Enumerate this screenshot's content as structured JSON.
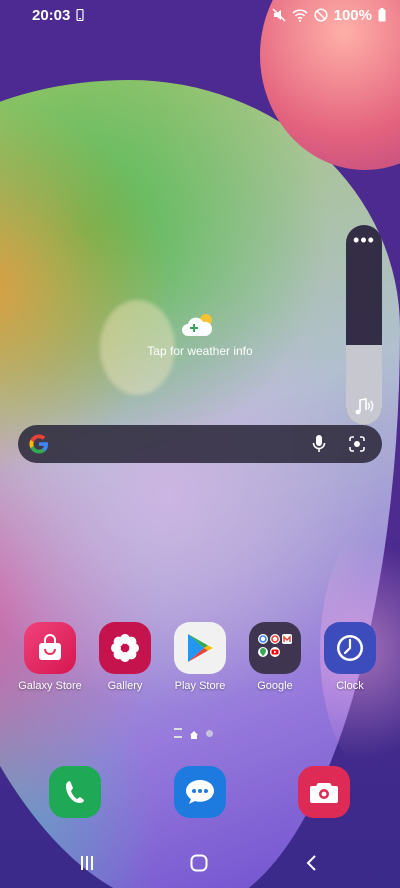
{
  "status_bar": {
    "time": "20:03",
    "battery": "100%",
    "icons": [
      "phone-screen-icon",
      "mute-icon",
      "wifi-icon",
      "do-not-disturb-icon",
      "battery-icon"
    ]
  },
  "weather": {
    "label": "Tap for weather info"
  },
  "volume": {
    "level_percent": 40
  },
  "search": {
    "icons": [
      "google-logo",
      "mic-icon",
      "lens-icon"
    ]
  },
  "apps": [
    {
      "label": "Galaxy Store",
      "icon": "galaxy-store-icon",
      "color": "#e8315f"
    },
    {
      "label": "Gallery",
      "icon": "gallery-icon",
      "color": "#c4134d"
    },
    {
      "label": "Play Store",
      "icon": "play-store-icon",
      "color": "#f1f1f1"
    },
    {
      "label": "Google",
      "icon": "google-folder-icon",
      "color": "#3f3551"
    },
    {
      "label": "Clock",
      "icon": "clock-icon",
      "color": "#3d4cbd"
    }
  ],
  "dock": [
    {
      "icon": "phone-icon",
      "color": "#1fa855"
    },
    {
      "icon": "messages-icon",
      "color": "#1d7be0"
    },
    {
      "icon": "camera-icon",
      "color": "#dd2b55"
    }
  ],
  "nav": [
    "recents-icon",
    "home-icon",
    "back-icon"
  ]
}
